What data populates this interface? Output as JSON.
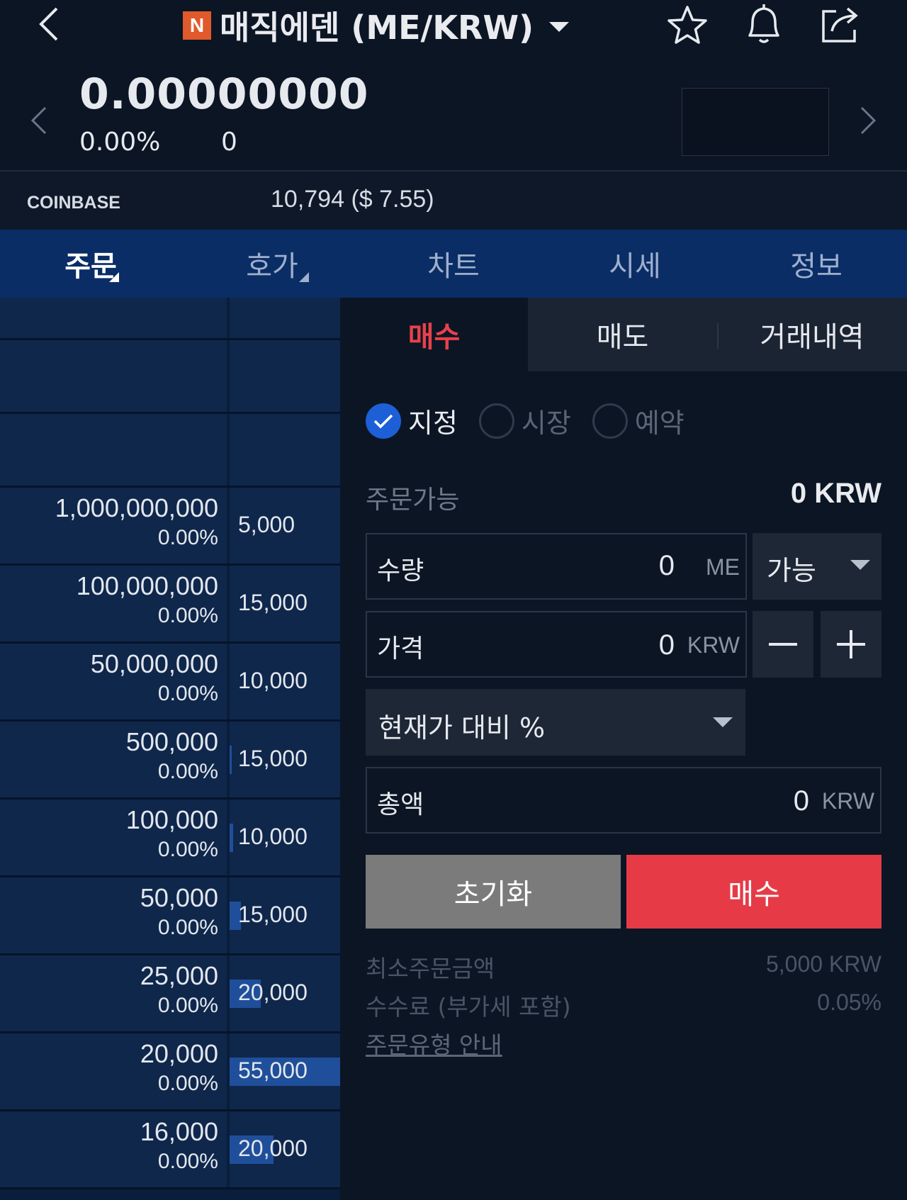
{
  "header": {
    "badge": "N",
    "title": "매직에덴 (ME/KRW)"
  },
  "price_block": {
    "price": "0.00000000",
    "change_pct": "0.00%",
    "change_val": "0"
  },
  "coinbase": {
    "label": "COINBASE",
    "value": "10,794 ($ 7.55)"
  },
  "tabs": [
    {
      "label": "주문"
    },
    {
      "label": "호가"
    },
    {
      "label": "차트"
    },
    {
      "label": "시세"
    },
    {
      "label": "정보"
    }
  ],
  "orderbook": {
    "rows": [
      {
        "price": "1,000,000,000",
        "pct": "0.00%",
        "qty": "5,000",
        "fill": 0
      },
      {
        "price": "100,000,000",
        "pct": "0.00%",
        "qty": "15,000",
        "fill": 0
      },
      {
        "price": "50,000,000",
        "pct": "0.00%",
        "qty": "10,000",
        "fill": 0
      },
      {
        "price": "500,000",
        "pct": "0.00%",
        "qty": "15,000",
        "fill": 0.02
      },
      {
        "price": "100,000",
        "pct": "0.00%",
        "qty": "10,000",
        "fill": 0.03
      },
      {
        "price": "50,000",
        "pct": "0.00%",
        "qty": "15,000",
        "fill": 0.1
      },
      {
        "price": "25,000",
        "pct": "0.00%",
        "qty": "20,000",
        "fill": 0.28
      },
      {
        "price": "20,000",
        "pct": "0.00%",
        "qty": "55,000",
        "fill": 1.0
      },
      {
        "price": "16,000",
        "pct": "0.00%",
        "qty": "20,000",
        "fill": 0.4
      }
    ]
  },
  "order_panel": {
    "subtabs": [
      {
        "label": "매수"
      },
      {
        "label": "매도"
      },
      {
        "label": "거래내역"
      }
    ],
    "order_types": [
      {
        "label": "지정",
        "checked": true
      },
      {
        "label": "시장",
        "checked": false
      },
      {
        "label": "예약",
        "checked": false
      }
    ],
    "available_label": "주문가능",
    "available_value": "0 KRW",
    "quantity": {
      "label": "수량",
      "value": "0",
      "unit": "ME"
    },
    "quantity_dropdown": "가능",
    "price": {
      "label": "가격",
      "value": "0",
      "unit": "KRW"
    },
    "percent_dropdown": "현재가 대비 %",
    "total": {
      "label": "총액",
      "value": "0",
      "unit": "KRW"
    },
    "reset_label": "초기화",
    "buy_label": "매수",
    "min_order_label": "최소주문금액",
    "min_order_value": "5,000 KRW",
    "fee_label": "수수료 (부가세 포함)",
    "fee_value": "0.05%",
    "guide_link": "주문유형 안내"
  },
  "colors": {
    "background": "#0c1524",
    "tab_bar": "#0b2d66",
    "buy_red": "#e63b46",
    "check_blue": "#1d5fd6",
    "depth_bar": "#1f4f9a"
  }
}
